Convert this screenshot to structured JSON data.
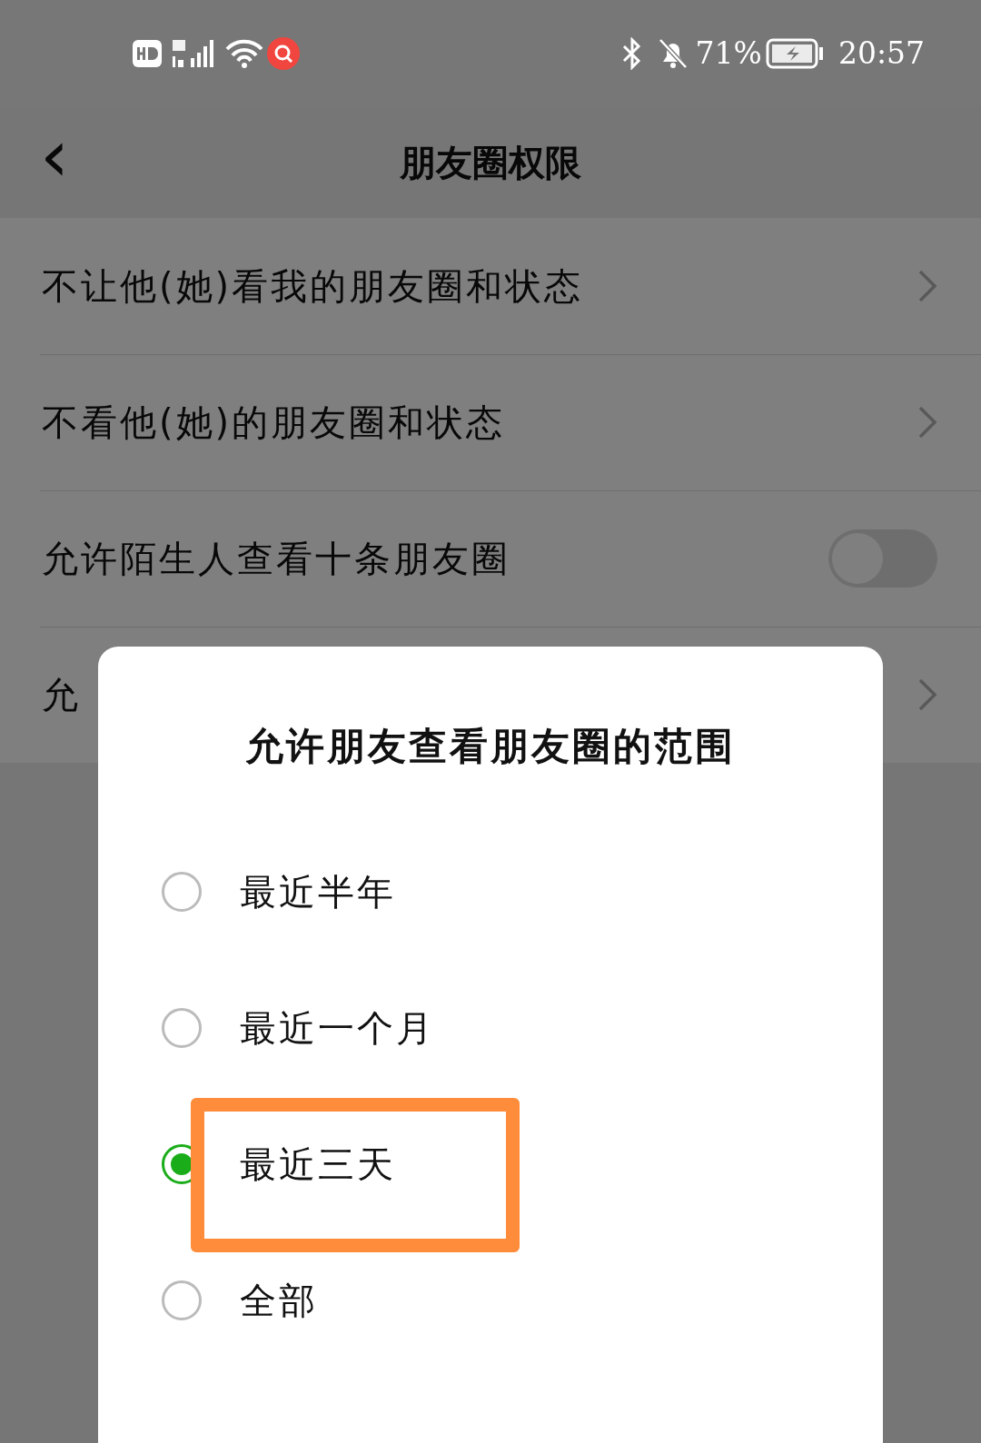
{
  "status_bar": {
    "battery": "71%",
    "time": "20:57"
  },
  "header": {
    "back": "‹",
    "title": "朋友圈权限"
  },
  "rows": [
    {
      "kind": "link",
      "label": "不让他(她)看我的朋友圈和状态"
    },
    {
      "kind": "link",
      "label": "不看他(她)的朋友圈和状态"
    },
    {
      "kind": "toggle",
      "label": "允许陌生人查看十条朋友圈",
      "on": false
    },
    {
      "kind": "link",
      "label": "允"
    }
  ],
  "dialog": {
    "title": "允许朋友查看朋友圈的范围",
    "options": [
      {
        "label": "最近半年",
        "selected": false,
        "highlighted": false
      },
      {
        "label": "最近一个月",
        "selected": false,
        "highlighted": false
      },
      {
        "label": "最近三天",
        "selected": true,
        "highlighted": true
      },
      {
        "label": "全部",
        "selected": false,
        "highlighted": false
      }
    ]
  }
}
